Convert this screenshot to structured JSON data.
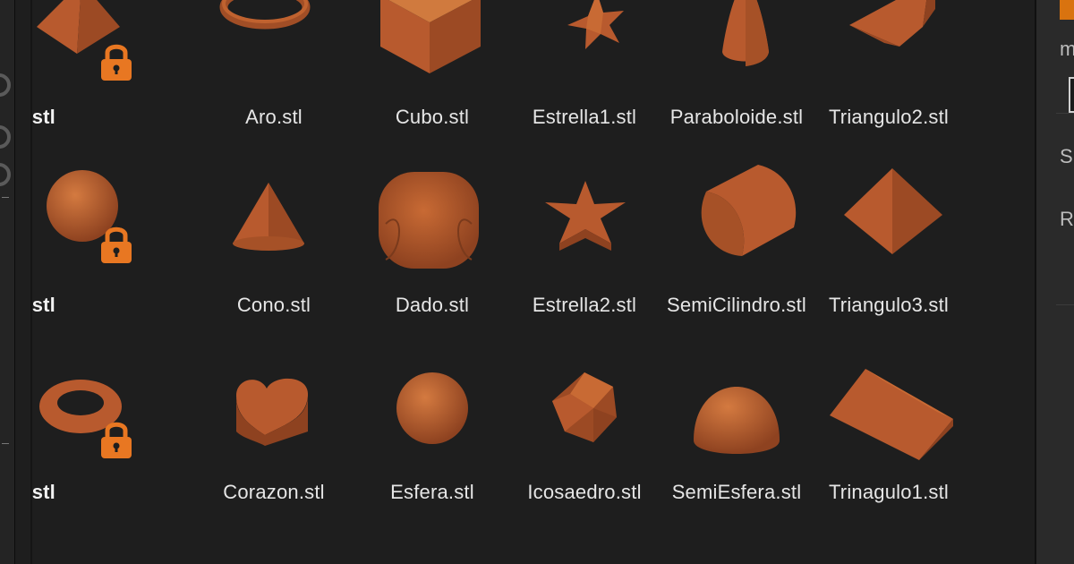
{
  "accent_color": "#e87722",
  "shape_color": "#b85a2e",
  "files": [
    {
      "name": "yramid.stl",
      "shape": "pyramid",
      "locked": true,
      "builtin": true
    },
    {
      "name": "Aro.stl",
      "shape": "ring",
      "locked": false,
      "builtin": false
    },
    {
      "name": "Cubo.stl",
      "shape": "cube",
      "locked": false,
      "builtin": false
    },
    {
      "name": "Estrella1.stl",
      "shape": "star-flat",
      "locked": false,
      "builtin": false
    },
    {
      "name": "Paraboloide.stl",
      "shape": "paraboloid",
      "locked": false,
      "builtin": false
    },
    {
      "name": "Triangulo2.stl",
      "shape": "wedge",
      "locked": false,
      "builtin": false
    },
    {
      "name": "sphere.stl",
      "shape": "sphere",
      "locked": true,
      "builtin": true
    },
    {
      "name": "Cono.stl",
      "shape": "cone",
      "locked": false,
      "builtin": false
    },
    {
      "name": "Dado.stl",
      "shape": "die",
      "locked": false,
      "builtin": false
    },
    {
      "name": "Estrella2.stl",
      "shape": "star-extruded",
      "locked": false,
      "builtin": false
    },
    {
      "name": "SemiCilindro.stl",
      "shape": "half-cylinder",
      "locked": false,
      "builtin": false
    },
    {
      "name": "Triangulo3.stl",
      "shape": "diamond",
      "locked": false,
      "builtin": false
    },
    {
      "name": "torus.stl",
      "shape": "torus",
      "locked": true,
      "builtin": true
    },
    {
      "name": "Corazon.stl",
      "shape": "heart",
      "locked": false,
      "builtin": false
    },
    {
      "name": "Esfera.stl",
      "shape": "sphere-small",
      "locked": false,
      "builtin": false
    },
    {
      "name": "Icosaedro.stl",
      "shape": "icosahedron",
      "locked": false,
      "builtin": false
    },
    {
      "name": "SemiEsfera.stl",
      "shape": "hemisphere",
      "locked": false,
      "builtin": false
    },
    {
      "name": "Trinagulo1.stl",
      "shape": "prism",
      "locked": false,
      "builtin": false
    }
  ],
  "right_panel": {
    "letters": [
      "m",
      "S",
      "R"
    ]
  }
}
